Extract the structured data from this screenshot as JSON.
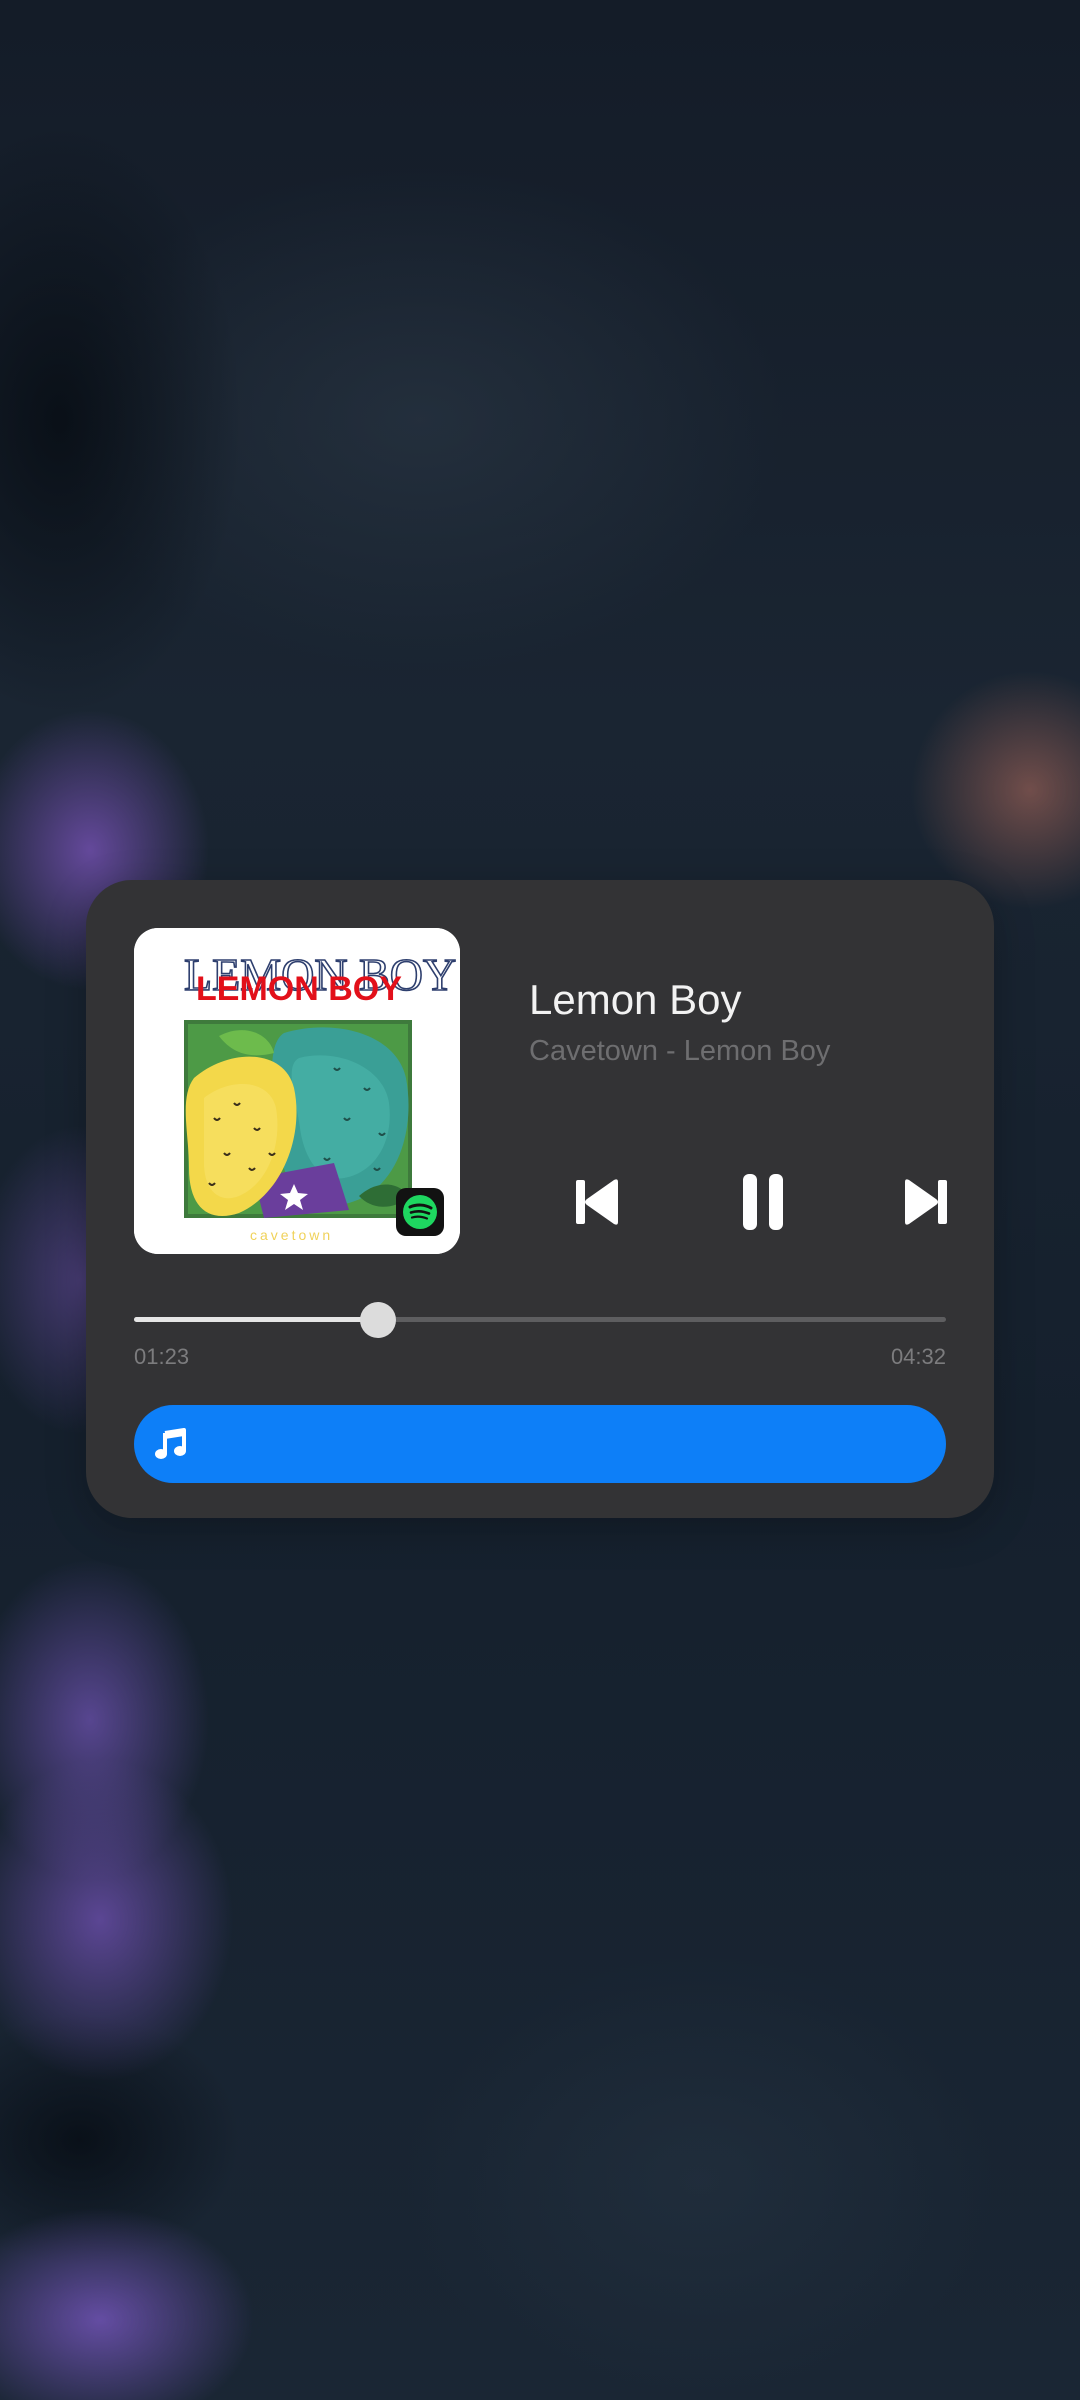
{
  "player": {
    "title": "Lemon Boy",
    "subtitle": "Cavetown - Lemon Boy",
    "elapsed": "01:23",
    "duration": "04:32",
    "progress_fraction": 0.3,
    "album_art": {
      "title_text": "LEMON BOY",
      "artist_text": "cavetown"
    },
    "source_icon": "spotify-icon",
    "output_icon": "music-note-icon",
    "colors": {
      "card": "#333335",
      "accent": "#0d7ff8",
      "title": "#f2f2f2",
      "subtitle": "#6e6e70",
      "spotify_green": "#1ed760"
    }
  }
}
